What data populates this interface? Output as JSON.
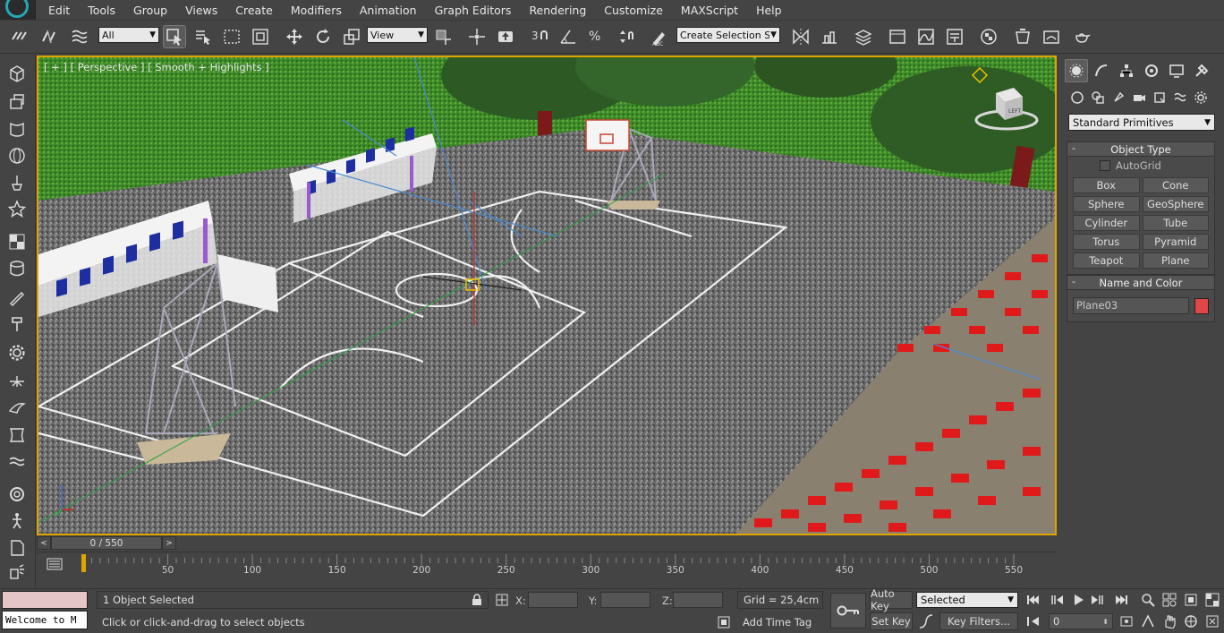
{
  "menu": {
    "items": [
      "Edit",
      "Tools",
      "Group",
      "Views",
      "Create",
      "Modifiers",
      "Animation",
      "Graph Editors",
      "Rendering",
      "Customize",
      "MAXScript",
      "Help"
    ]
  },
  "toolbar": {
    "selection_filter": "All",
    "reference_coord": "View",
    "named_selection_placeholder": "Create Selection Se"
  },
  "viewport": {
    "label": "[ + ] [ Perspective ] [ Smooth + Highlights ]",
    "viewcube_face": "LEFT"
  },
  "command_panel": {
    "category": "Standard Primitives",
    "object_type_title": "Object Type",
    "autogrid_label": "AutoGrid",
    "primitives": [
      "Box",
      "Cone",
      "Sphere",
      "GeoSphere",
      "Cylinder",
      "Tube",
      "Torus",
      "Pyramid",
      "Teapot",
      "Plane"
    ],
    "name_color_title": "Name and Color",
    "object_name": "Plane03",
    "object_color": "#e04848"
  },
  "timeline": {
    "frame_display": "0 / 550",
    "ticks": [
      "50",
      "100",
      "150",
      "200",
      "250",
      "300",
      "350",
      "400",
      "450",
      "500",
      "550"
    ],
    "tick_frames": [
      50,
      100,
      150,
      200,
      250,
      300,
      350,
      400,
      450,
      500,
      550
    ],
    "max_frame": 550
  },
  "status": {
    "maxscript_text": "Welcome to M",
    "selection_info": "1 Object Selected",
    "prompt": "Click or click-and-drag to select objects",
    "x_label": "X:",
    "y_label": "Y:",
    "z_label": "Z:",
    "grid": "Grid = 25,4cm",
    "add_time_tag": "Add Time Tag",
    "auto_key": "Auto Key",
    "set_key": "Set Key",
    "key_mode": "Selected",
    "key_filters": "Key Filters...",
    "current_frame": "0"
  },
  "colors": {
    "accent_viewport_border": "#e0a400",
    "logo_ring": "#25a7b5"
  }
}
